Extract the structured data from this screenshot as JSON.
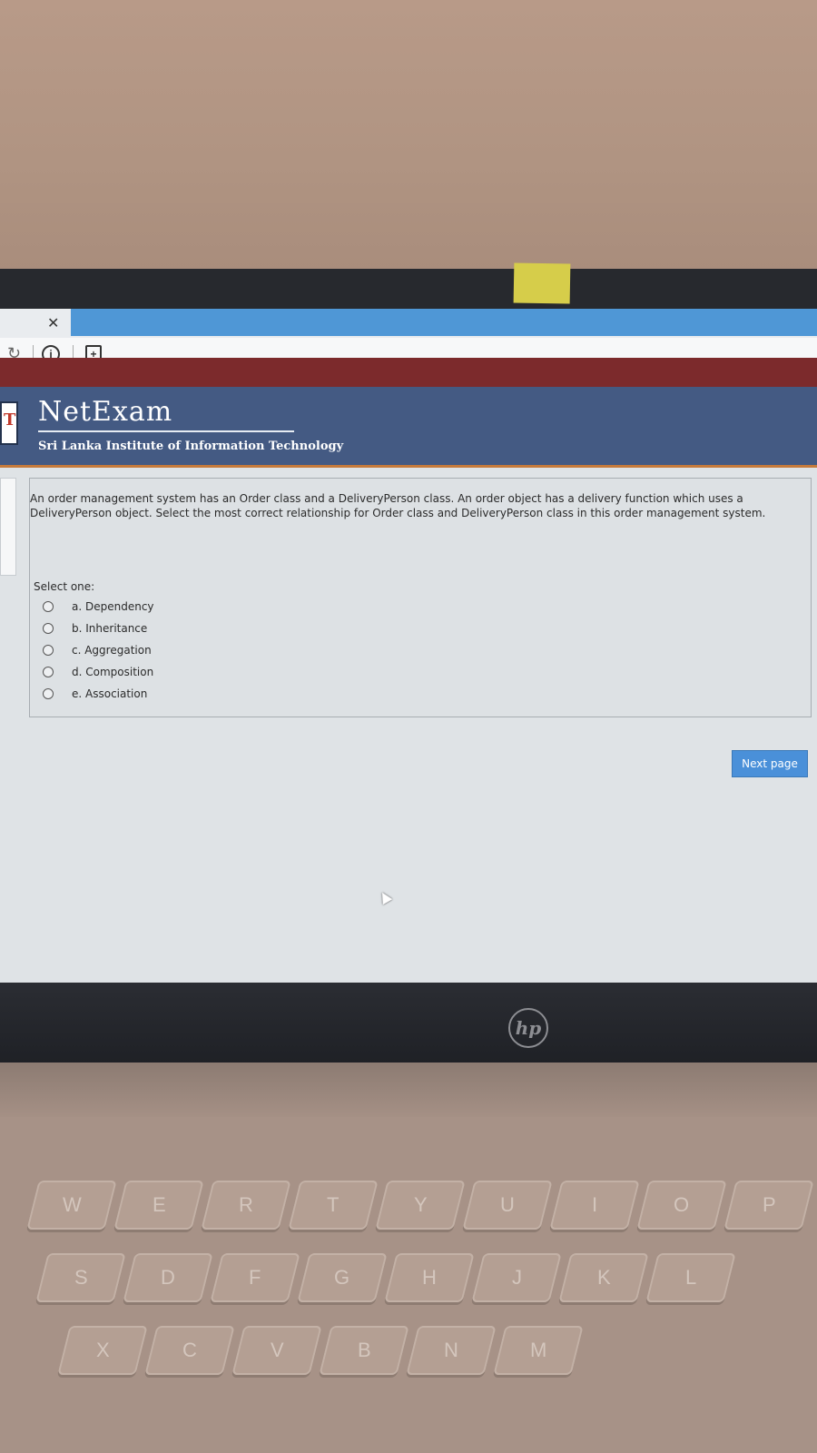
{
  "browser": {
    "tab_close_glyph": "✕",
    "reload_glyph": "↻",
    "info_glyph": "i",
    "page_glyph": "+"
  },
  "header": {
    "brand": "NetExam",
    "institute": "Sri Lanka Institute of Information Technology"
  },
  "question": {
    "text": "An order management system has an Order class and a DeliveryPerson class. An order object has a delivery function which uses a DeliveryPerson object. Select the most correct relationship for Order class and DeliveryPerson class in this order management system.",
    "select_label": "Select one:",
    "options": [
      "a. Dependency",
      "b. Inheritance",
      "c. Aggregation",
      "d. Composition",
      "e. Association"
    ]
  },
  "next_button": "Next page",
  "hardware": {
    "logo": "hp",
    "keys_row1": [
      "W",
      "E",
      "R",
      "T",
      "Y",
      "U",
      "I",
      "O",
      "P"
    ],
    "keys_row2": [
      "S",
      "D",
      "F",
      "G",
      "H",
      "J",
      "K",
      "L"
    ],
    "keys_row3": [
      "X",
      "C",
      "V",
      "B",
      "N",
      "M"
    ]
  },
  "colors": {
    "header_bg": "#445a83",
    "header_accent": "#c67a3b",
    "red_strip": "#7c2a2c",
    "tab_active": "#4f97d6",
    "button": "#4a90d9"
  }
}
